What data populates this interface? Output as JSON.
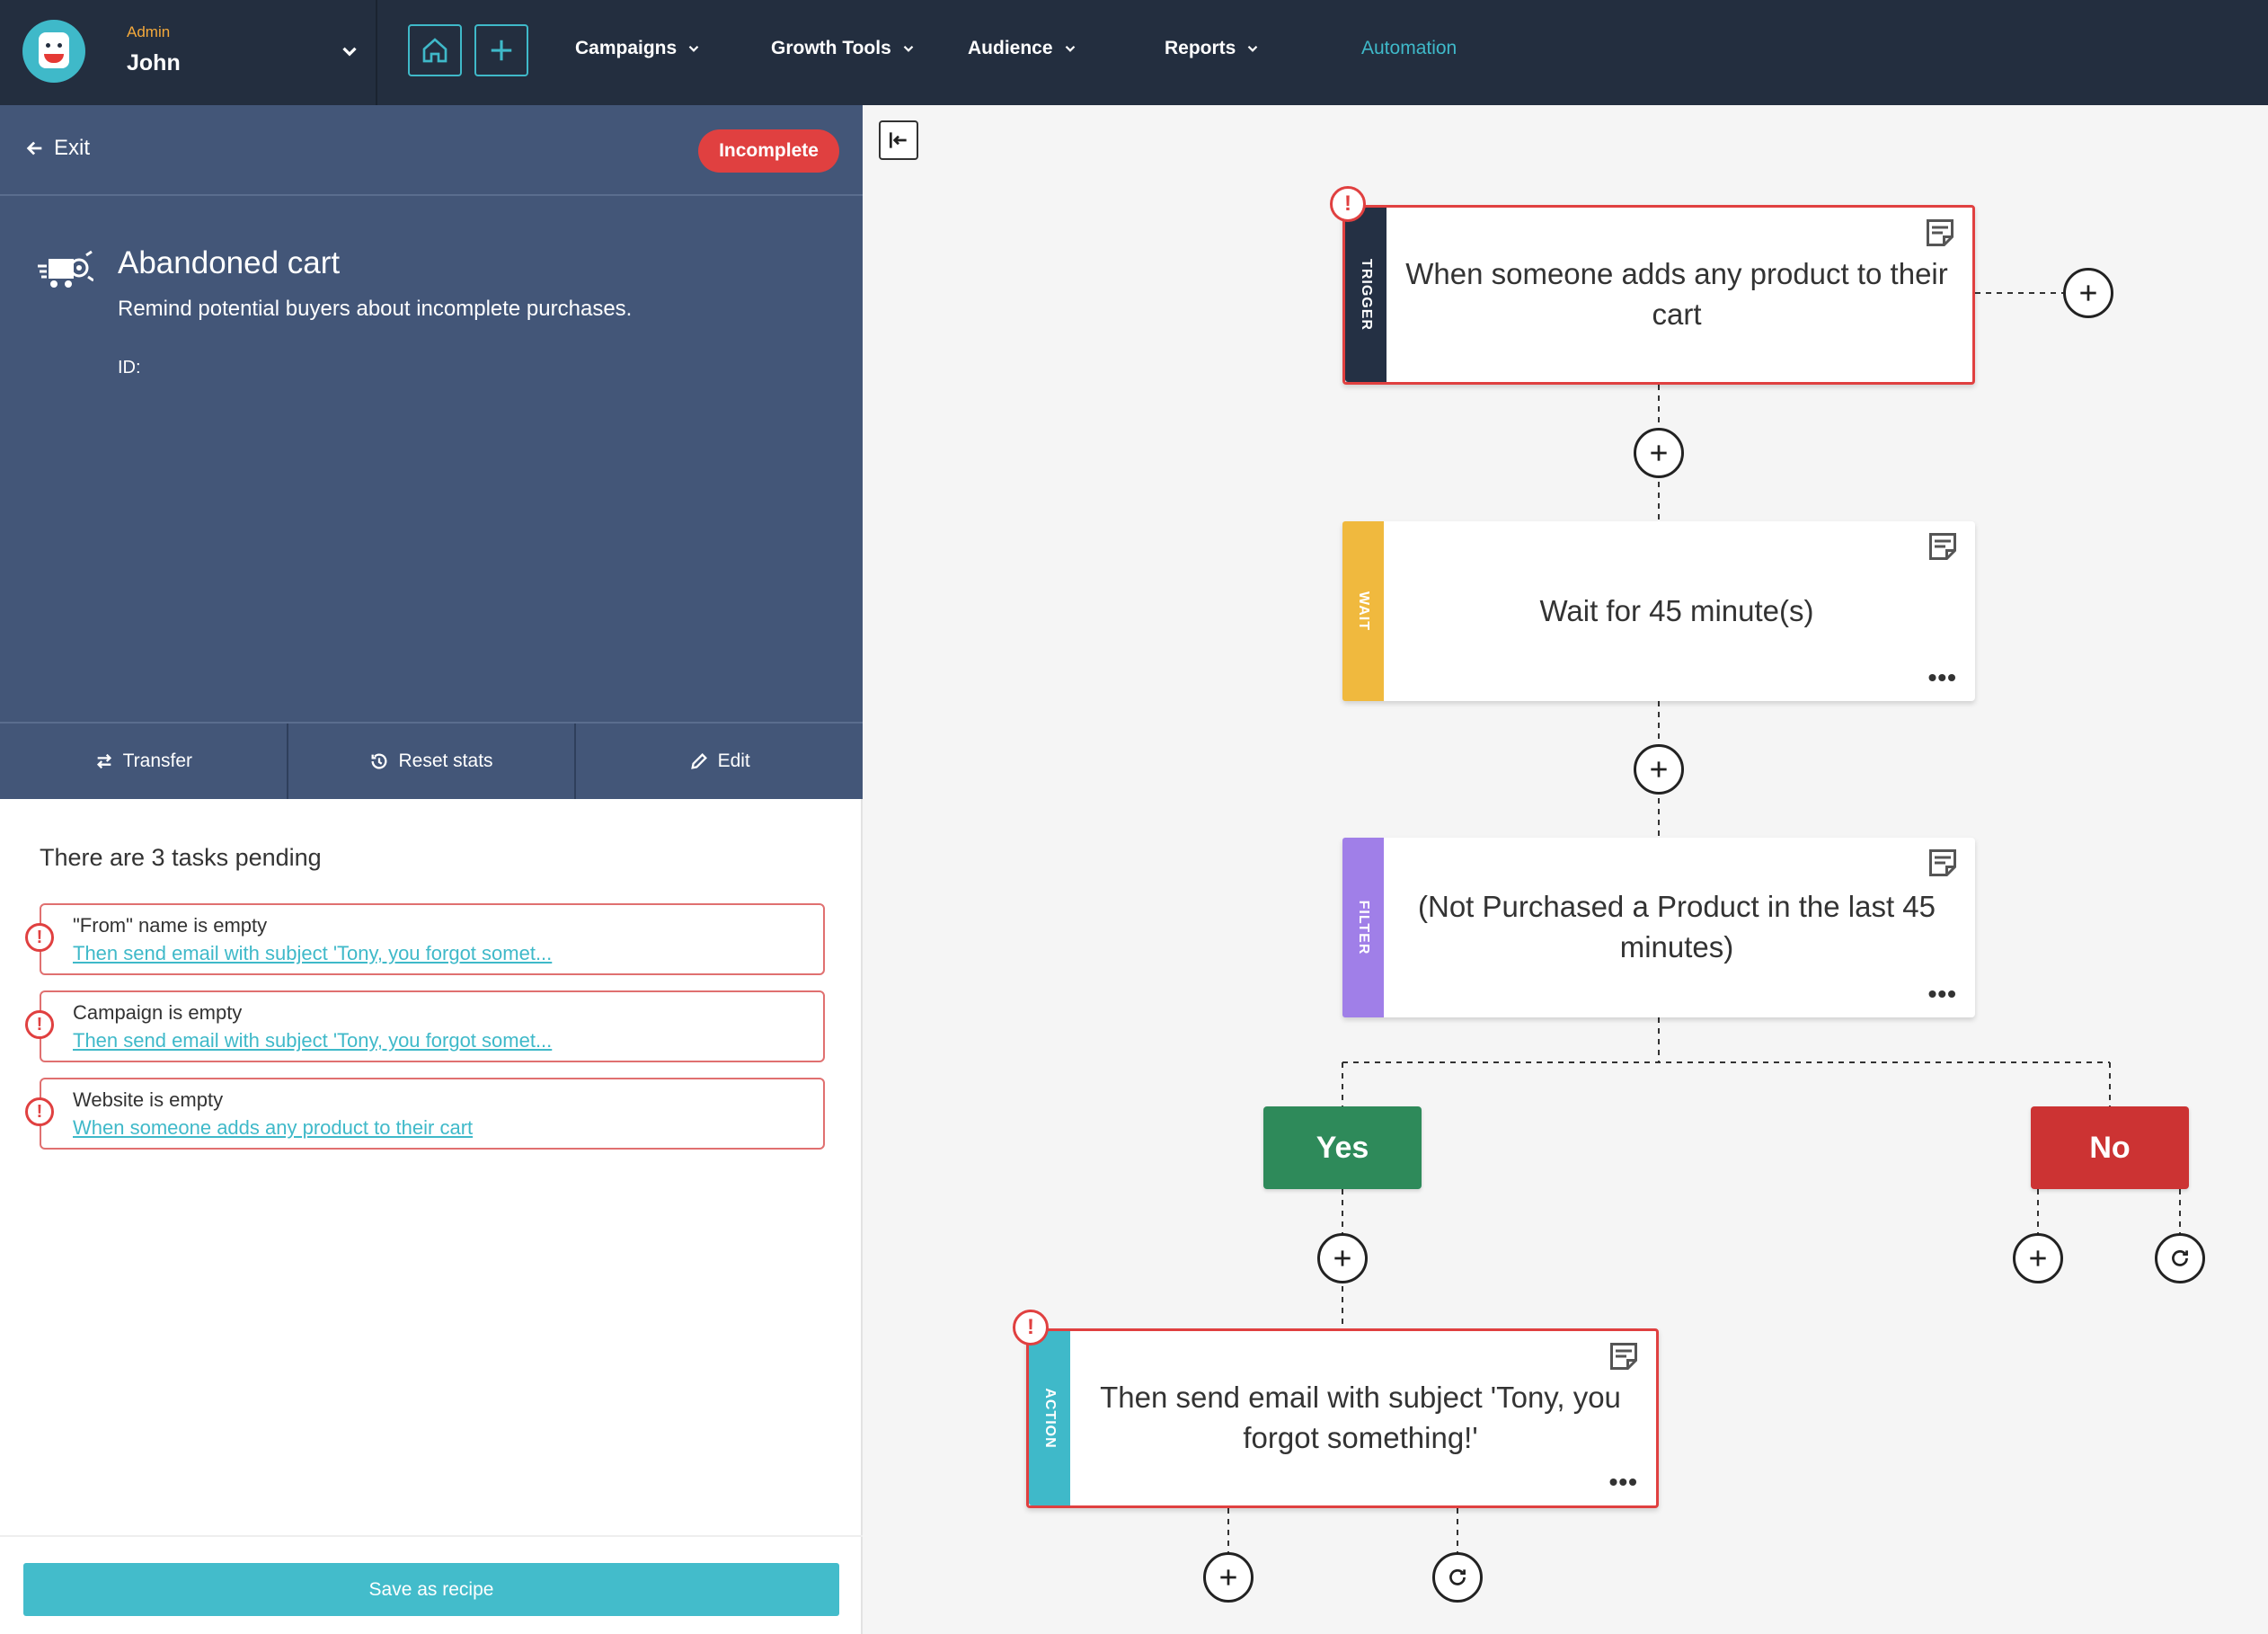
{
  "topbar": {
    "user_role": "Admin",
    "user_name": "John",
    "nav": [
      {
        "label": "Campaigns"
      },
      {
        "label": "Growth Tools"
      },
      {
        "label": "Audience"
      },
      {
        "label": "Reports"
      },
      {
        "label": "Automation"
      }
    ]
  },
  "sidebar": {
    "exit_label": "Exit",
    "status_badge": "Incomplete",
    "title": "Abandoned cart",
    "description": "Remind potential buyers about incomplete purchases.",
    "id_label": "ID:",
    "actions": [
      {
        "label": "Transfer",
        "icon": "swap-icon"
      },
      {
        "label": "Reset stats",
        "icon": "history-icon"
      },
      {
        "label": "Edit",
        "icon": "pencil-icon"
      }
    ],
    "tasks_heading": "There are 3 tasks pending",
    "tasks": [
      {
        "title": "\"From\" name is empty",
        "link": "Then send email with subject 'Tony, you forgot somet..."
      },
      {
        "title": "Campaign is empty",
        "link": "Then send email with subject 'Tony, you forgot somet..."
      },
      {
        "title": "Website is empty",
        "link": "When someone adds any product to their cart"
      }
    ],
    "save_button": "Save as recipe"
  },
  "workflow": {
    "trigger": {
      "tag": "TRIGGER",
      "text": "When someone adds any product to their cart"
    },
    "wait": {
      "tag": "WAIT",
      "text": "Wait for 45 minute(s)"
    },
    "filter": {
      "tag": "FILTER",
      "text": "(Not Purchased a Product in the last 45 minutes)"
    },
    "branch_yes": "Yes",
    "branch_no": "No",
    "action": {
      "tag": "ACTION",
      "text": "Then send email with subject 'Tony, you forgot something!'"
    },
    "more_label": "•••"
  },
  "colors": {
    "topbar": "#232e3f",
    "panel": "#435678",
    "accent": "#3fb9c9",
    "error": "#e04040",
    "trigger": "#243044",
    "wait": "#f0b93e",
    "filter": "#a07fe8",
    "action": "#3fb9c9",
    "yes": "#2e8a5a",
    "no": "#cc3333"
  }
}
